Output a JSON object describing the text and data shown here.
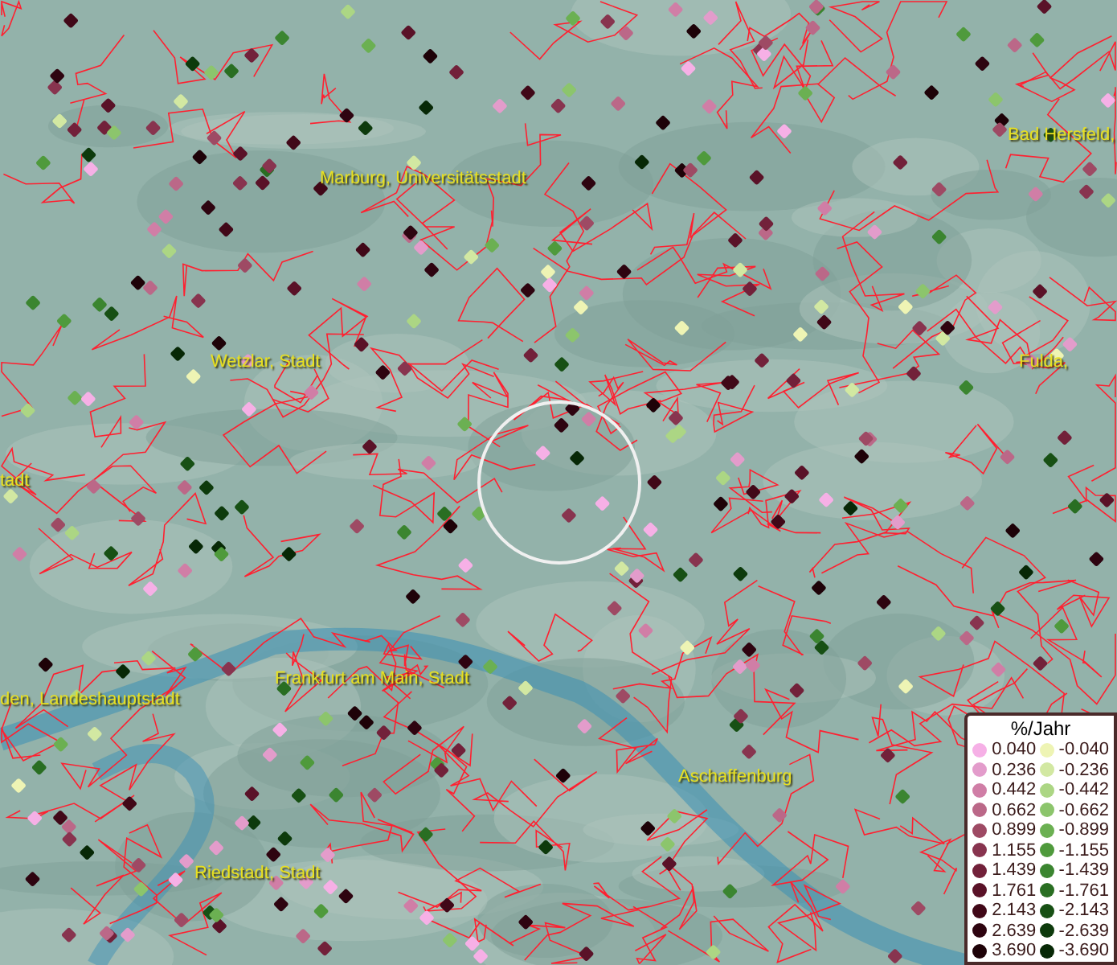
{
  "map": {
    "labels": [
      {
        "text": "Bad Hersfeld,",
        "kind": "city"
      },
      {
        "text": "Marburg, Universitätsstadt",
        "kind": "city"
      },
      {
        "text": "Wetzlar, Stadt",
        "kind": "city"
      },
      {
        "text": "Fulda, ",
        "kind": "city"
      },
      {
        "text": "tadt",
        "kind": "city"
      },
      {
        "text": "den, Landeshauptstadt",
        "kind": "city"
      },
      {
        "text": "Frankfurt am Main, Stadt",
        "kind": "city"
      },
      {
        "text": "Aschaffenburg",
        "kind": "city"
      },
      {
        "text": "Riedstadt, Stadt",
        "kind": "city"
      }
    ]
  },
  "legend": {
    "title": "%/Jahr",
    "rows": [
      {
        "positive": {
          "value": "0.040",
          "color": "#f6b0e6"
        },
        "negative": {
          "value": "-0.040",
          "color": "#eef4b4"
        }
      },
      {
        "positive": {
          "value": "0.236",
          "color": "#e39ccb"
        },
        "negative": {
          "value": "-0.236",
          "color": "#d2e8a2"
        }
      },
      {
        "positive": {
          "value": "0.442",
          "color": "#d07ea6"
        },
        "negative": {
          "value": "-0.442",
          "color": "#acd684"
        }
      },
      {
        "positive": {
          "value": "0.662",
          "color": "#bb6888"
        },
        "negative": {
          "value": "-0.662",
          "color": "#8cc56c"
        }
      },
      {
        "positive": {
          "value": "0.899",
          "color": "#9e4a64"
        },
        "negative": {
          "value": "-0.899",
          "color": "#6bb052"
        }
      },
      {
        "positive": {
          "value": "1.155",
          "color": "#88344f"
        },
        "negative": {
          "value": "-1.155",
          "color": "#4f9a3c"
        }
      },
      {
        "positive": {
          "value": "1.439",
          "color": "#72213a"
        },
        "negative": {
          "value": "-1.439",
          "color": "#3b8530"
        }
      },
      {
        "positive": {
          "value": "1.761",
          "color": "#5a1228"
        },
        "negative": {
          "value": "-1.761",
          "color": "#296e22"
        }
      },
      {
        "positive": {
          "value": "2.143",
          "color": "#410818"
        },
        "negative": {
          "value": "-2.143",
          "color": "#175014"
        }
      },
      {
        "positive": {
          "value": "2.639",
          "color": "#2e0410"
        },
        "negative": {
          "value": "-2.639",
          "color": "#0d3a0c"
        }
      },
      {
        "positive": {
          "value": "3.690",
          "color": "#1e0208"
        },
        "negative": {
          "value": "-3.690",
          "color": "#072806"
        }
      }
    ]
  }
}
